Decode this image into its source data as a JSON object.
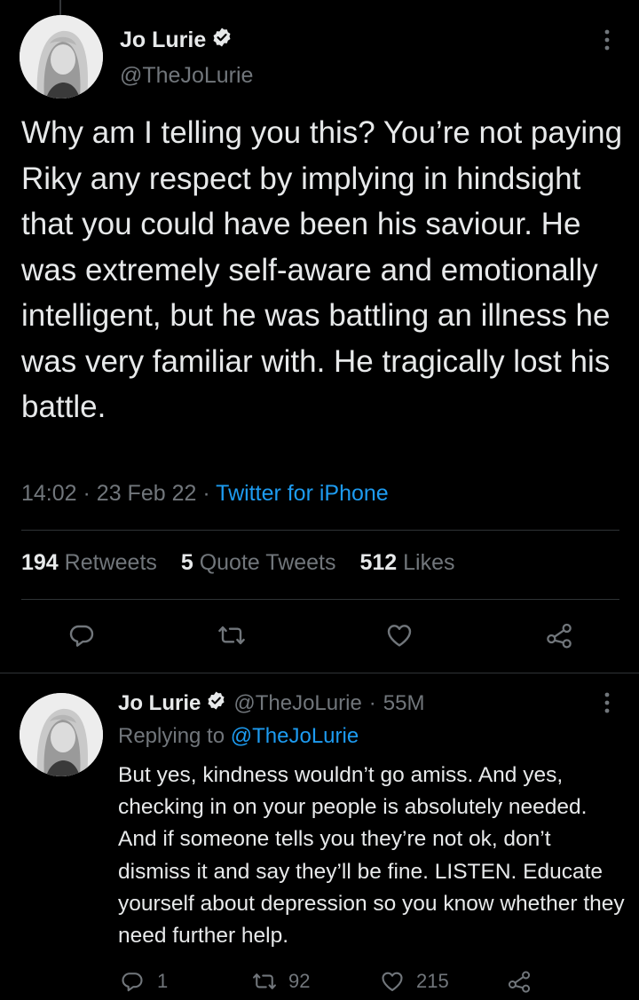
{
  "main_tweet": {
    "author_name": "Jo Lurie",
    "handle": "@TheJoLurie",
    "text": "Why am I telling you this? You’re not paying Riky any respect by implying in hindsight that you could have been his saviour. He was extremely self-aware and emotionally intelligent, but he was battling an illness he was very familiar with. He tragically lost his battle.",
    "time": "14:02",
    "date": "23 Feb 22",
    "separator": "·",
    "source": "Twitter for iPhone",
    "stats": {
      "retweets_count": "194",
      "retweets_label": "Retweets",
      "quotes_count": "5",
      "quotes_label": "Quote Tweets",
      "likes_count": "512",
      "likes_label": "Likes"
    }
  },
  "reply_tweet": {
    "author_name": "Jo Lurie",
    "handle": "@TheJoLurie",
    "separator": "·",
    "age": "55M",
    "replying_prefix": "Replying to",
    "replying_handle": "@TheJoLurie",
    "text": "But yes, kindness wouldn’t go amiss. And yes, checking in on your people is absolutely needed. And if someone tells you they’re not ok, don’t dismiss it and say they’ll be fine. LISTEN. Educate yourself about depression so you know whether they need further help.",
    "counts": {
      "replies": "1",
      "retweets": "92",
      "likes": "215"
    }
  },
  "colors": {
    "background": "#000000",
    "text": "#e7e9ea",
    "muted": "#71767b",
    "accent": "#1d9bf0",
    "divider": "#2f3336"
  },
  "icons": [
    "verified-badge-icon",
    "more-options-icon",
    "reply-icon",
    "retweet-icon",
    "like-icon",
    "share-icon"
  ]
}
